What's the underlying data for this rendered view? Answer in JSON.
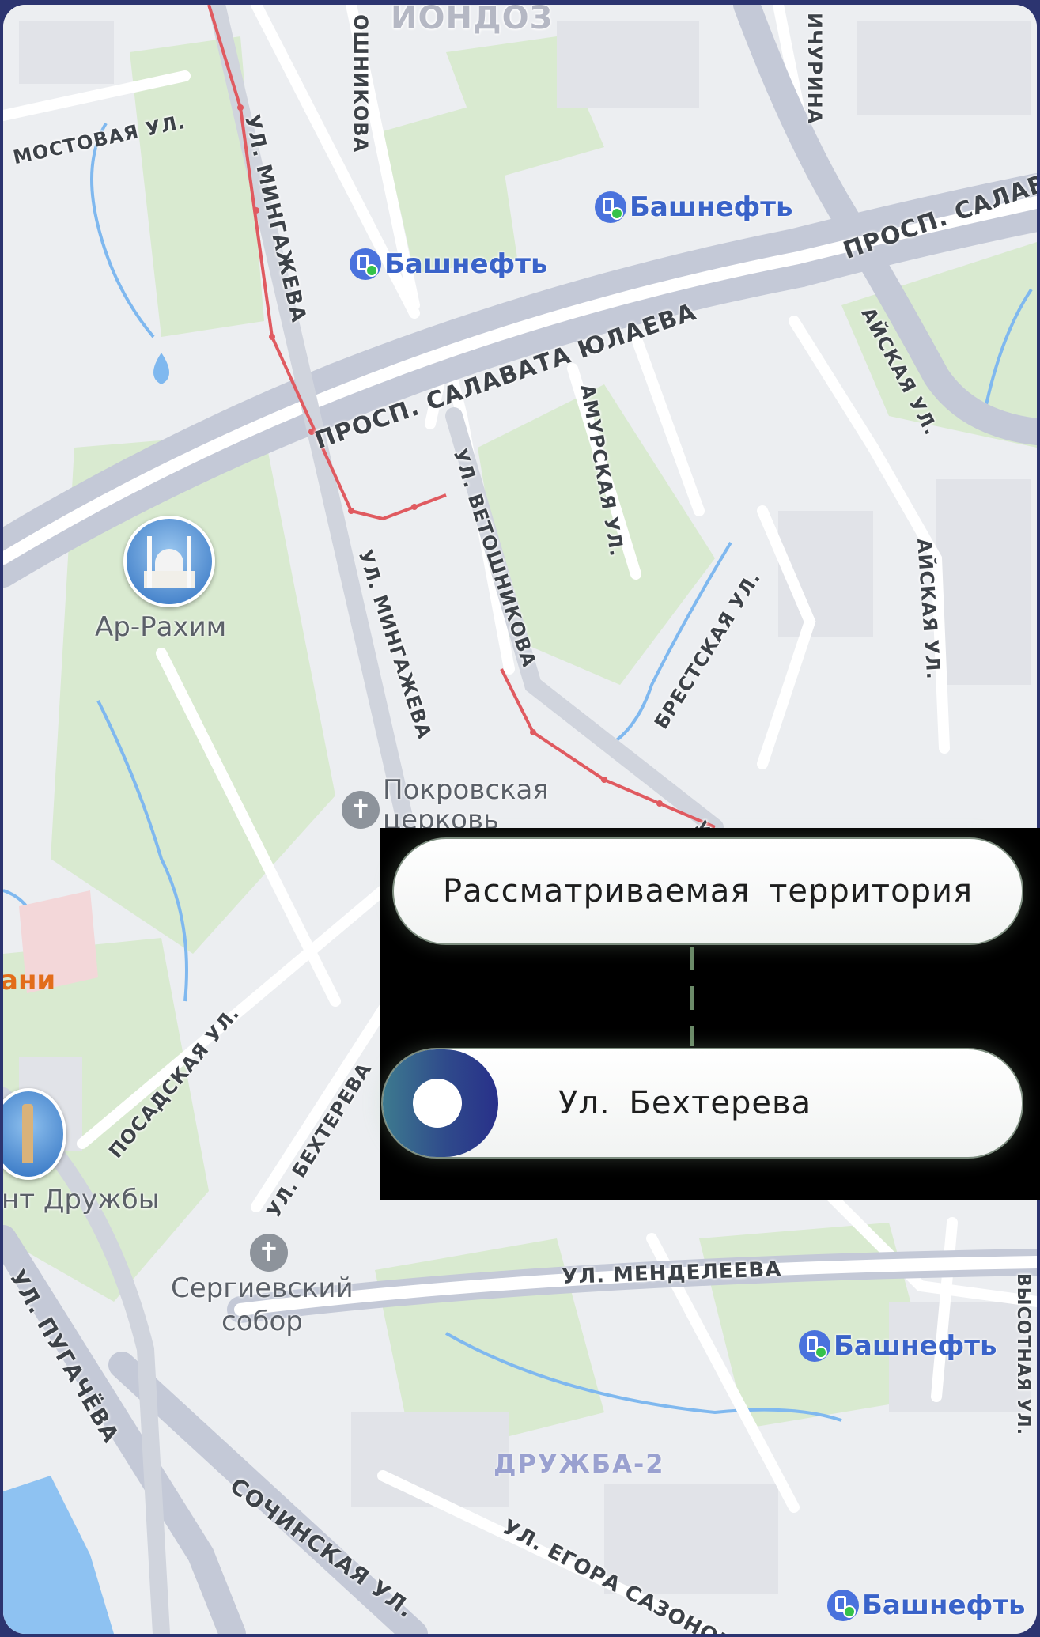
{
  "map": {
    "district_top": "ЙОНДОЗ",
    "district_bottom": "ДРУЖБА-2",
    "orange_partial": "ани",
    "streets": {
      "mostovaya": "МОСТОВАЯ УЛ.",
      "mingazheva_1": "УЛ. МИНГАЖЕВА",
      "mingazheva_2": "УЛ. МИНГАЖЕВА",
      "veteoshnikova_top": "ОШНИКОВА",
      "michurina": "ИЧУРИНА",
      "salavata_main": "ПРОСП. САЛАВАТА ЮЛАЕВА",
      "salavata_right": "ПРОСП. САЛАВА",
      "veteoshnikova": "УЛ. ВЕТОШНИКОВА",
      "amurskaya": "АМУРСКАЯ УЛ.",
      "aiskaya_1": "АЙСКАЯ УЛ.",
      "aiskaya_2": "АЙСКАЯ УЛ.",
      "brestskaya": "БРЕСТСКАЯ УЛ.",
      "posadskaya": "ПОСАДСКАЯ УЛ.",
      "bekhtereva": "УЛ. БЕХТЕРЕВА",
      "mendeleeva": "УЛ. МЕНДЕЛЕЕВА",
      "vysotnaya": "ВЫСОТНАЯ УЛ.",
      "pugacheva": "УЛ. ПУГАЧЁВА",
      "sochinskaya": "СОЧИНСКАЯ УЛ.",
      "egora_sazonova": "УЛ. ЕГОРА САЗОНОВ",
      "partial_ul": "УЛ"
    },
    "pois": {
      "bashneft_1": "Башнефть",
      "bashneft_2": "Башнефть",
      "bashneft_3": "Башнефть",
      "bashneft_4": "Башнефть",
      "ar_rakhim": "Ар-Рахим",
      "pokrovskaya": "Покровская\nцерковь",
      "pokrovskaya_line1": "Покровская",
      "pokrovskaya_line2": "церковь",
      "druzhby": "нт Дружбы",
      "sergievsky_line1": "Сергиевский",
      "sergievsky_line2": "собор"
    },
    "icons": {
      "fuel": "fuel-station-icon",
      "church": "church-cross-icon",
      "mosque": "mosque-icon",
      "monument": "monument-icon"
    },
    "colors": {
      "route": "#e05a60",
      "road_major": "#c4c9d7",
      "green": "#d9ead0",
      "water": "#7fb8ef",
      "fuel_text": "#3a63c9"
    }
  },
  "legend": {
    "top_label": "Рассматриваемая  территория",
    "bottom_label": "Ул. Бехтерева",
    "marker_colors": [
      "#3d7a8f",
      "#28308a"
    ],
    "connector_color": "#6b8a68"
  }
}
